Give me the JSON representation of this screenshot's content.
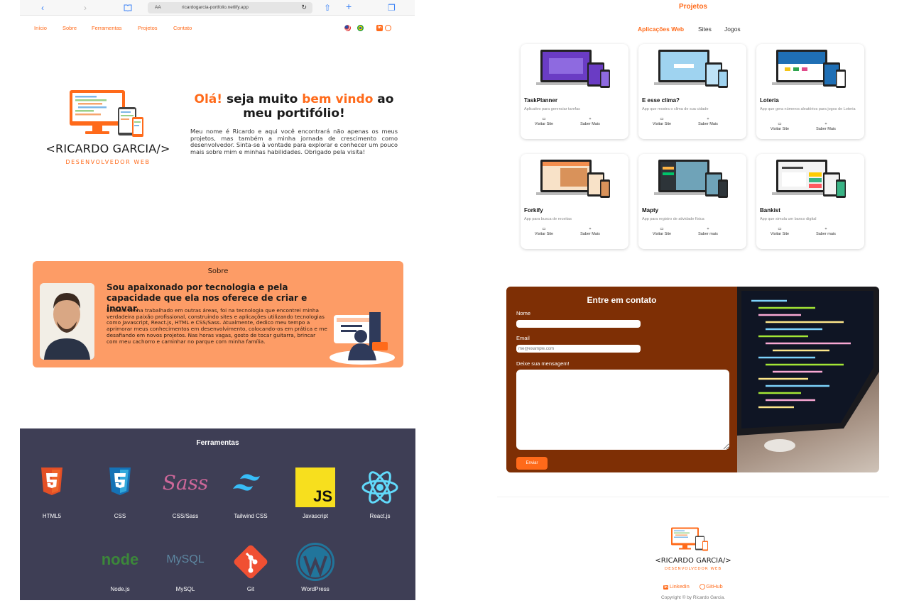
{
  "browser": {
    "back_icon": "chevron-left-icon",
    "forward_icon": "chevron-right-icon",
    "url_aa": "AA",
    "url": "ricardogarcia-portfolio.netlify.app",
    "reload_icon": "reload-icon"
  },
  "nav": {
    "items": [
      "Início",
      "Sobre",
      "Ferramentas",
      "Projetos",
      "Contato"
    ],
    "social_linkedin": "in",
    "social_github": "◎"
  },
  "hero": {
    "name": "<RICARDO GARCIA/>",
    "role": "DESENVOLVEDOR WEB",
    "title_part1": "Olá!",
    "title_part2": " seja muito ",
    "title_part3": "bem vindo",
    "title_part4": " ao meu portifólio!",
    "text": "Meu nome é Ricardo e aqui você encontrará não apenas os meus projetos, mas também a minha jornada de crescimento como desenvolvedor. Sinta-se à vontade para explorar e conhecer um pouco mais sobre mim e minhas habilidades. Obrigado pela visita!"
  },
  "about": {
    "heading": "Sobre",
    "title": "Sou apaixonado por tecnologia e pela capacidade que ela nos oferece de criar e inovar.",
    "text": "Embora tenha trabalhado em outras áreas, foi na tecnologia que encontrei minha verdadeira paixão profissional, construindo sites e aplicações utilizando tecnologias como Javascript, React.js, HTML e CSS/Sass. Atualmente, dedico meu tempo a aprimorar meus conhecimentos em desenvolvimento, colocando-os em prática e me desafiando em novos projetos. Nas horas vagas, gosto de tocar guitarra, brincar com meu cachorro e caminhar no parque com minha família."
  },
  "tools": {
    "heading": "Ferramentas",
    "items": [
      {
        "label": "HTML5",
        "icon": "html5-icon"
      },
      {
        "label": "CSS",
        "icon": "css3-icon"
      },
      {
        "label": "CSS/Sass",
        "icon": "sass-icon"
      },
      {
        "label": "Tailwind CSS",
        "icon": "tailwind-icon"
      },
      {
        "label": "Javascript",
        "icon": "javascript-icon"
      },
      {
        "label": "React.js",
        "icon": "react-icon"
      },
      {
        "label": "Node.js",
        "icon": "nodejs-icon"
      },
      {
        "label": "MySQL",
        "icon": "mysql-icon"
      },
      {
        "label": "Git",
        "icon": "git-icon"
      },
      {
        "label": "WordPress",
        "icon": "wordpress-icon"
      }
    ],
    "js_text": "JS",
    "sass_text": "Sass",
    "node_text": "node",
    "mysql_text": "MySQL"
  },
  "projects": {
    "heading": "Projetos",
    "tabs": [
      "Aplicações Web",
      "Sites",
      "Jogos"
    ],
    "cards": [
      {
        "title": "TaskPlanner",
        "desc": "Aplicativo para gerenciar tarefas",
        "visit": "Visitar Site",
        "more": "Saber Mais"
      },
      {
        "title": "E esse clima?",
        "desc": "App que mostra o clima de sua cidade",
        "visit": "Visitar Site",
        "more": "Saber Mais"
      },
      {
        "title": "Loteria",
        "desc": "App que gera números aleatórios para jogos de Loteria",
        "visit": "Visitar Site",
        "more": "Saber Mais"
      },
      {
        "title": "Forkify",
        "desc": "App para busca de receitas",
        "visit": "Visitar Site",
        "more": "Saber Mais"
      },
      {
        "title": "Mapty",
        "desc": "App para registro de atividade física",
        "visit": "Visitar Site",
        "more": "Saber mais"
      },
      {
        "title": "Bankist",
        "desc": "App que simula um banco digital",
        "visit": "Visitar Site",
        "more": "Saber mais"
      }
    ]
  },
  "contact": {
    "heading": "Entre em contato",
    "name_label": "Nome",
    "email_label": "Email",
    "email_placeholder": "me@example.com",
    "message_label": "Deixe sua mensagem!",
    "send_label": "Enviar"
  },
  "footer": {
    "name": "<RICARDO GARCIA/>",
    "role": "DESENVOLVEDOR WEB",
    "linkedin": "Linkedin",
    "github": "GitHub",
    "copyright": "Copyright © by Ricardo Garcia."
  },
  "colors": {
    "accent": "#ff6a1a",
    "about_bg": "#fd9c66",
    "tools_bg": "#3e3e55",
    "contact_bg": "#7e2f05"
  }
}
